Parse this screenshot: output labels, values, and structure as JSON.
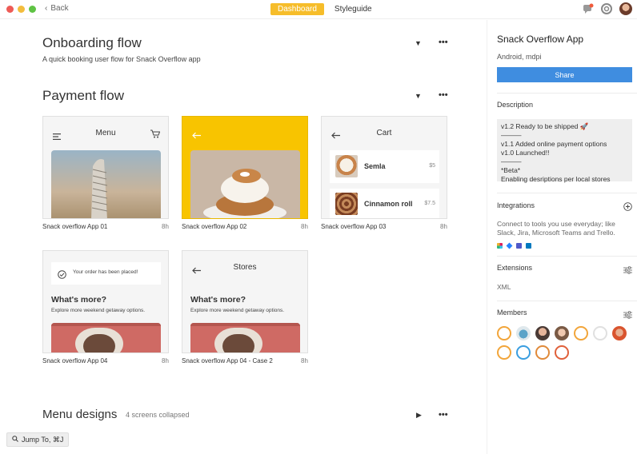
{
  "titlebar": {
    "back_label": "Back",
    "tabs": [
      {
        "label": "Dashboard",
        "active": true
      },
      {
        "label": "Styleguide",
        "active": false
      }
    ]
  },
  "sections": [
    {
      "title": "Onboarding flow",
      "subtitle": "A quick booking user flow for Snack Overflow app"
    },
    {
      "title": "Payment flow"
    },
    {
      "title": "Menu designs",
      "meta": "4 screens collapsed"
    }
  ],
  "screens": [
    {
      "caption": "Snack overflow App 01",
      "time": "8h",
      "header": "Menu"
    },
    {
      "caption": "Snack overflow App 02",
      "time": "8h"
    },
    {
      "caption": "Snack overflow App 03",
      "time": "8h",
      "header": "Cart",
      "items": [
        {
          "name": "Semla",
          "price": "$5"
        },
        {
          "name": "Cinnamon roll",
          "price": "$7.5"
        }
      ]
    },
    {
      "caption": "Snack overflow App 04",
      "time": "8h",
      "toast": "Your order has been placed!",
      "heading": "What's more?",
      "text": "Explore more weekend getaway options."
    },
    {
      "caption": "Snack overflow App 04 - Case 2",
      "time": "8h",
      "header": "Stores",
      "heading": "What's more?",
      "text": "Explore more weekend getaway options."
    }
  ],
  "sidebar": {
    "title": "Snack Overflow App",
    "subtitle": "Android, mdpi",
    "share_label": "Share",
    "description_heading": "Description",
    "description_lines": [
      "v1.2 Ready to be shipped 🚀",
      "———",
      "v1.1 Added online payment options",
      "v1.0 Launched!!",
      "———",
      "*Beta*",
      "Enabling desriptions per local stores"
    ],
    "integrations_heading": "Integrations",
    "integrations_text_1": "Connect to tools you use everyday; like",
    "integrations_text_2": "Slack, Jira, Microsoft Teams and Trello.",
    "extensions_heading": "Extensions",
    "extensions_value": "XML",
    "members_heading": "Members"
  },
  "jump": {
    "label": "Jump To, ⌘J"
  },
  "colors": {
    "accent": "#f6bd2a",
    "share": "#3f8de0",
    "yellow_card": "#f8c400"
  }
}
